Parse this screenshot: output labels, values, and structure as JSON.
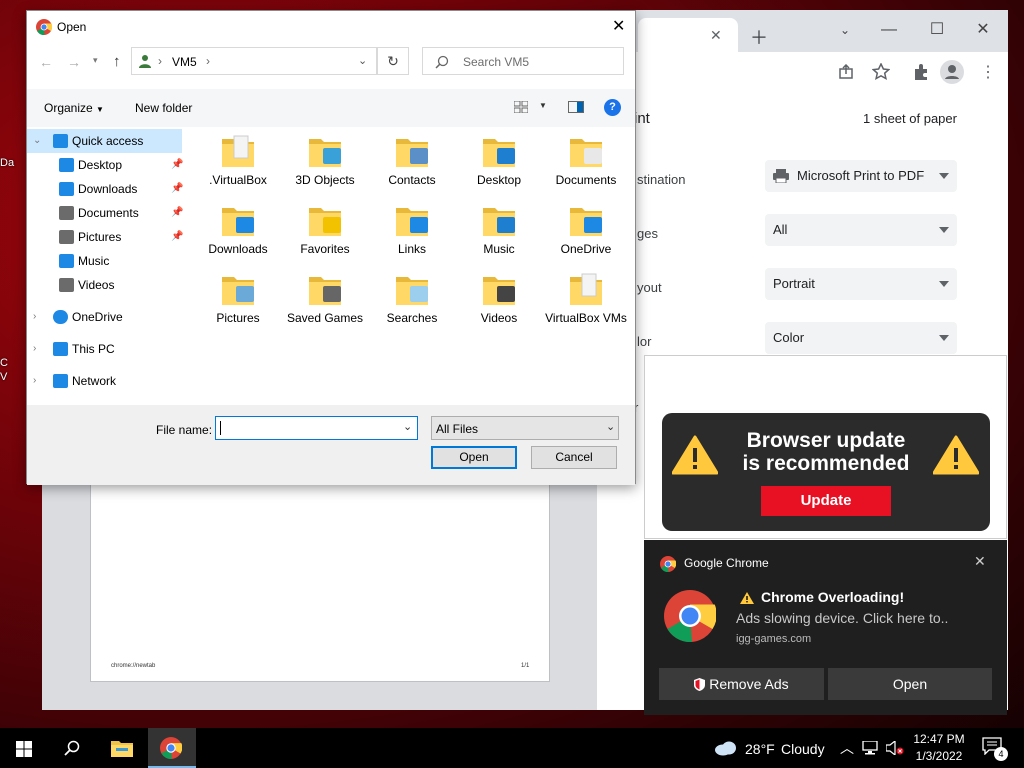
{
  "desktop": {
    "left_labels": [
      "Da",
      "C",
      "V"
    ]
  },
  "chrome": {
    "print": {
      "title_fragment": "int",
      "sheets": "1 sheet of paper",
      "rows": [
        {
          "label": "stination",
          "value": "Microsoft Print to PDF"
        },
        {
          "label": "ges",
          "value": "All"
        },
        {
          "label": "yout",
          "value": "Portrait"
        },
        {
          "label": "lor",
          "value": "Color"
        }
      ],
      "footer_left": "chrome://newtab",
      "footer_right": "1/1",
      "stray_letter": "r"
    }
  },
  "dialog": {
    "title": "Open",
    "path_label": "VM5",
    "search_placeholder": "Search VM5",
    "organize_label": "Organize",
    "new_folder_label": "New folder",
    "tree": [
      {
        "label": "Quick access",
        "icon": "star-icon",
        "level": 0,
        "expanded": true,
        "selected": true
      },
      {
        "label": "Desktop",
        "icon": "desktop-icon",
        "level": 1,
        "pinned": true
      },
      {
        "label": "Downloads",
        "icon": "download-icon",
        "level": 1,
        "pinned": true
      },
      {
        "label": "Documents",
        "icon": "documents-icon",
        "level": 1,
        "pinned": true
      },
      {
        "label": "Pictures",
        "icon": "pictures-icon",
        "level": 1,
        "pinned": true
      },
      {
        "label": "Music",
        "icon": "music-icon",
        "level": 1
      },
      {
        "label": "Videos",
        "icon": "videos-icon",
        "level": 1
      },
      {
        "label": "OneDrive",
        "icon": "cloud-icon",
        "level": 0
      },
      {
        "label": "This PC",
        "icon": "pc-icon",
        "level": 0
      },
      {
        "label": "Network",
        "icon": "network-icon",
        "level": 0
      }
    ],
    "items": [
      {
        "label": ".VirtualBox",
        "badge": "none"
      },
      {
        "label": "3D Objects",
        "badge": "cube"
      },
      {
        "label": "Contacts",
        "badge": "contact"
      },
      {
        "label": "Desktop",
        "badge": "desktop"
      },
      {
        "label": "Documents",
        "badge": "doc"
      },
      {
        "label": "Downloads",
        "badge": "download"
      },
      {
        "label": "Favorites",
        "badge": "star"
      },
      {
        "label": "Links",
        "badge": "link"
      },
      {
        "label": "Music",
        "badge": "music"
      },
      {
        "label": "OneDrive",
        "badge": "cloud"
      },
      {
        "label": "Pictures",
        "badge": "picture"
      },
      {
        "label": "Saved Games",
        "badge": "chess"
      },
      {
        "label": "Searches",
        "badge": "search"
      },
      {
        "label": "Videos",
        "badge": "film"
      },
      {
        "label": "VirtualBox VMs",
        "badge": "none"
      }
    ],
    "file_name_label": "File name:",
    "file_name_value": "",
    "file_type": "All Files",
    "open_label": "Open",
    "cancel_label": "Cancel"
  },
  "ad": {
    "headline_line1": "Browser update",
    "headline_line2": "is recommended",
    "button": "Update"
  },
  "notification": {
    "app": "Google Chrome",
    "title": "Chrome Overloading!",
    "body": "Ads slowing device. Click here to..",
    "source": "igg-games.com",
    "remove_ads": "Remove Ads",
    "open": "Open"
  },
  "taskbar": {
    "weather_temp": "28°F",
    "weather_desc": "Cloudy",
    "time": "12:47 PM",
    "date": "1/3/2022",
    "notification_count": "4"
  },
  "colors": {
    "accent": "#0078d7",
    "alert_red": "#e81123",
    "warning_yellow": "#ffc83d"
  }
}
